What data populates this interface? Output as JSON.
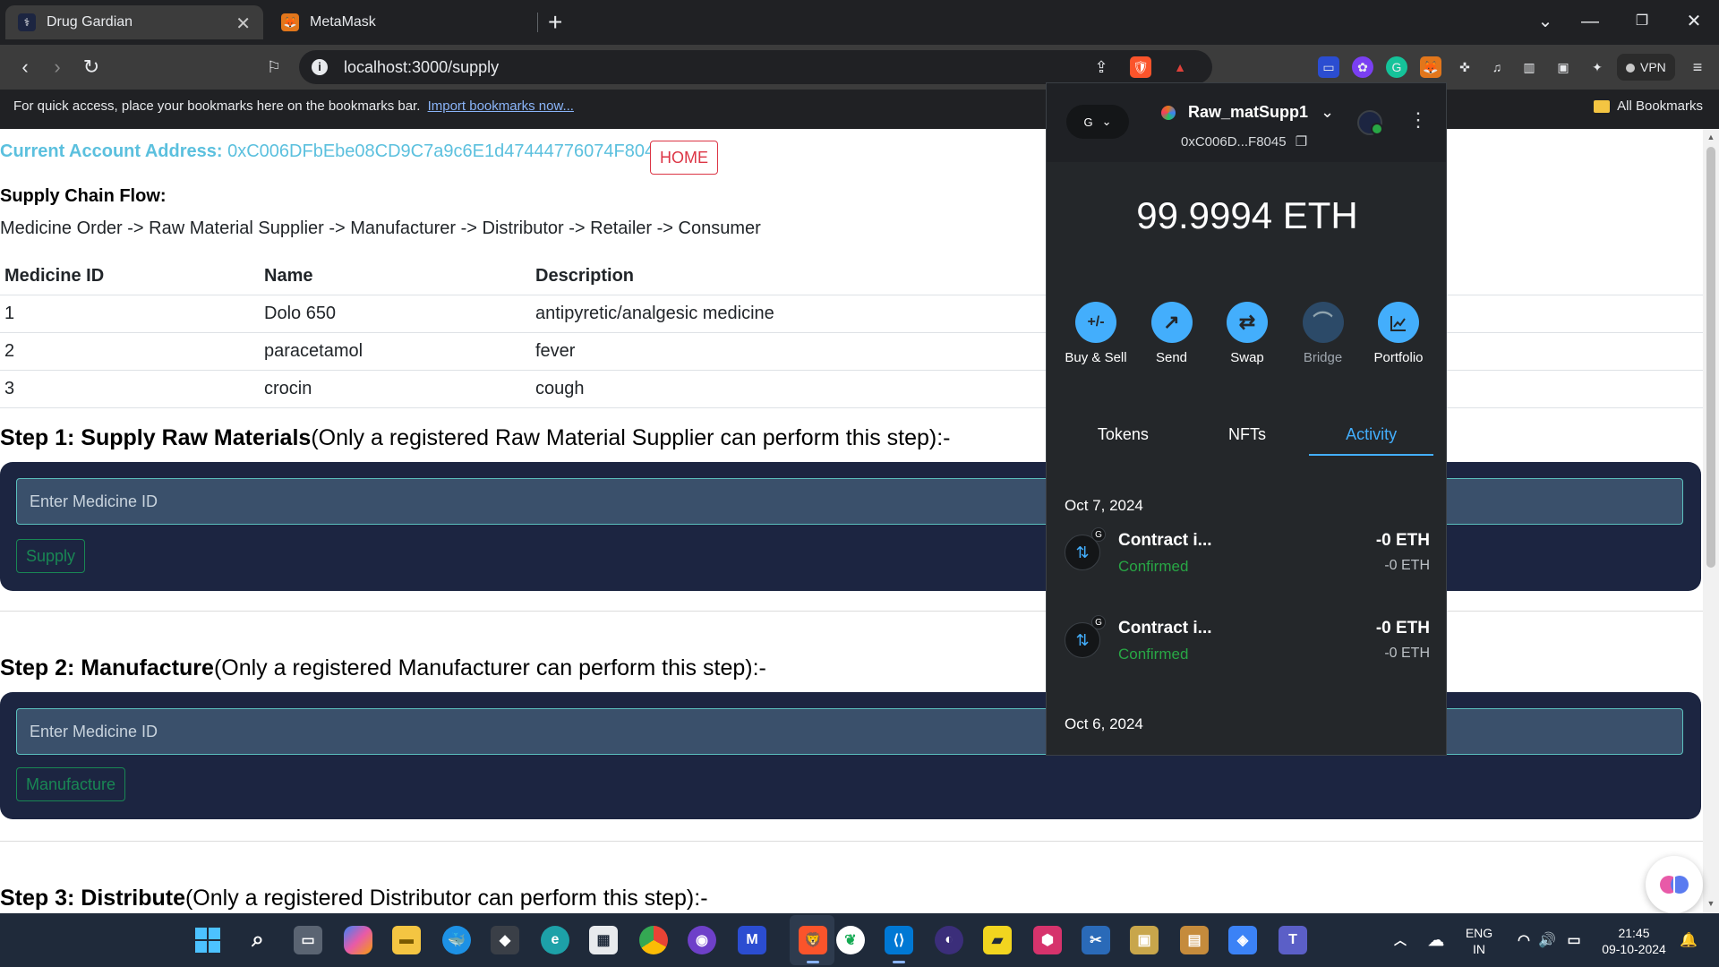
{
  "browser": {
    "tabs": [
      {
        "title": "Drug Gardian",
        "active": true
      },
      {
        "title": "MetaMask",
        "active": false
      }
    ],
    "url": "localhost:3000/supply",
    "bookmarks_bar": {
      "message": "For quick access, place your bookmarks here on the bookmarks bar.",
      "import_link": "Import bookmarks now...",
      "all_bookmarks": "All Bookmarks"
    },
    "vpn_label": "VPN"
  },
  "page": {
    "account_label": "Current Account Address:",
    "account_address": "0xC006DFbEbe08CD9C7a9c6E1d47444776074F8045",
    "home_button": "HOME",
    "flow_title": "Supply Chain Flow:",
    "flow": "Medicine Order -> Raw Material Supplier -> Manufacturer -> Distributor -> Retailer -> Consumer",
    "table": {
      "headers": [
        "Medicine ID",
        "Name",
        "Description"
      ],
      "rows": [
        [
          "1",
          "Dolo 650",
          "antipyretic/analgesic medicine"
        ],
        [
          "2",
          "paracetamol",
          "fever"
        ],
        [
          "3",
          "crocin",
          "cough"
        ]
      ]
    },
    "steps": [
      {
        "title_bold": "Step 1: Supply Raw Materials",
        "title_rest": "(Only a registered Raw Material Supplier can perform this step):-",
        "placeholder": "Enter Medicine ID",
        "button": "Supply"
      },
      {
        "title_bold": "Step 2: Manufacture",
        "title_rest": "(Only a registered Manufacturer can perform this step):-",
        "placeholder": "Enter Medicine ID",
        "button": "Manufacture"
      },
      {
        "title_bold": "Step 3: Distribute",
        "title_rest": "(Only a registered Distributor can perform this step):-"
      }
    ]
  },
  "metamask": {
    "network_letter": "G",
    "account_name": "Raw_matSupp1",
    "account_short": "0xC006D...F8045",
    "balance": "99.9994 ETH",
    "actions": [
      {
        "label": "Buy & Sell",
        "icon": "+/-",
        "enabled": true
      },
      {
        "label": "Send",
        "icon": "↗",
        "enabled": true
      },
      {
        "label": "Swap",
        "icon": "⇄",
        "enabled": true
      },
      {
        "label": "Bridge",
        "icon": "⌒",
        "enabled": false
      },
      {
        "label": "Portfolio",
        "icon": "📈",
        "enabled": true
      }
    ],
    "tabs": [
      "Tokens",
      "NFTs",
      "Activity"
    ],
    "active_tab": "Activity",
    "activity": [
      {
        "date": "Oct 7, 2024",
        "items": [
          {
            "title": "Contract i...",
            "status": "Confirmed",
            "amount": "-0 ETH",
            "amount_sub": "-0 ETH"
          },
          {
            "title": "Contract i...",
            "status": "Confirmed",
            "amount": "-0 ETH",
            "amount_sub": "-0 ETH"
          }
        ]
      },
      {
        "date": "Oct 6, 2024",
        "items": []
      }
    ]
  },
  "taskbar": {
    "lang_top": "ENG",
    "lang_bottom": "IN",
    "time": "21:45",
    "date": "09-10-2024"
  },
  "colors": {
    "accent_cyan": "#5bc0de",
    "danger": "#dc3545",
    "success": "#198754",
    "step_box": "#1c2541",
    "metamask_blue": "#43aefc"
  }
}
